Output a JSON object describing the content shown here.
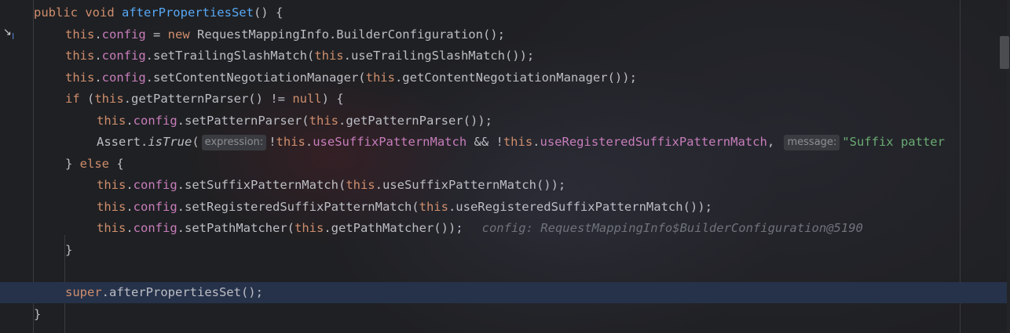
{
  "editor": {
    "method_name": "afterPropertiesSet",
    "hints": {
      "expression": "expression:",
      "message": "message:"
    },
    "inline_value": "config: RequestMappingInfo$BuilderConfiguration@5190",
    "strings": {
      "suffix_message": "\"Suffix patter"
    },
    "gutter_icons": [
      "execution-point-arrow-icon",
      "text-cursor-icon"
    ]
  }
}
